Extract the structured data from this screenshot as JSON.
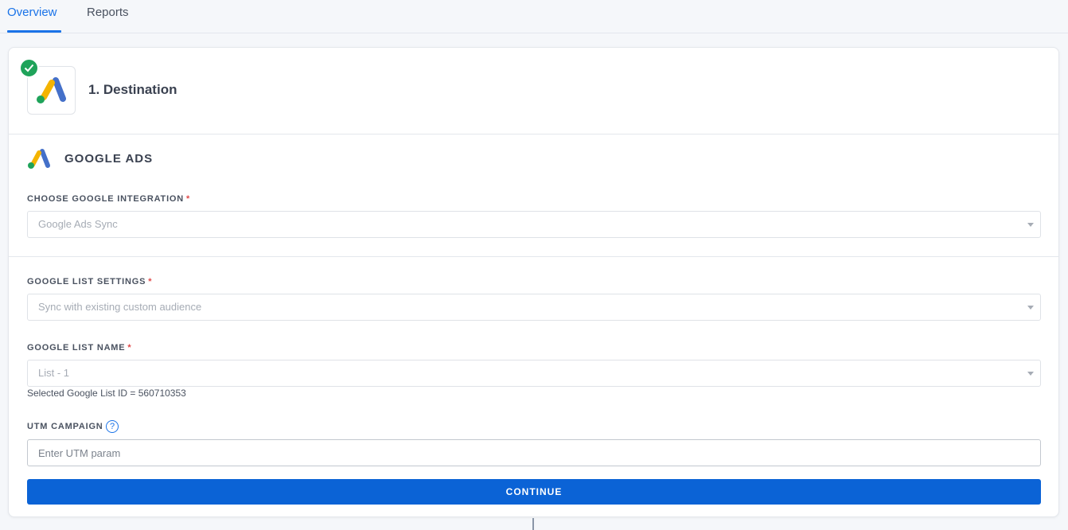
{
  "tabs": [
    {
      "label": "Overview",
      "active": true
    },
    {
      "label": "Reports",
      "active": false
    }
  ],
  "step": {
    "title": "1. Destination",
    "status": "complete",
    "icon": "google-ads-logo"
  },
  "section": {
    "title": "GOOGLE ADS"
  },
  "fields": {
    "integration": {
      "label": "CHOOSE GOOGLE INTEGRATION",
      "required_mark": "*",
      "value": "Google Ads Sync"
    },
    "list_settings": {
      "label": "GOOGLE LIST SETTINGS",
      "required_mark": "*",
      "value": "Sync with existing custom audience"
    },
    "list_name": {
      "label": "GOOGLE LIST NAME",
      "required_mark": "*",
      "value": "List - 1",
      "helper": "Selected Google List ID = 560710353"
    },
    "utm_campaign": {
      "label": "UTM CAMPAIGN",
      "help_glyph": "?",
      "placeholder": "Enter UTM param",
      "value": ""
    }
  },
  "actions": {
    "continue_label": "CONTINUE"
  },
  "colors": {
    "accent": "#1a73e8",
    "button": "#0b63d6",
    "success": "#1fa35a",
    "required": "#e04a4a"
  }
}
